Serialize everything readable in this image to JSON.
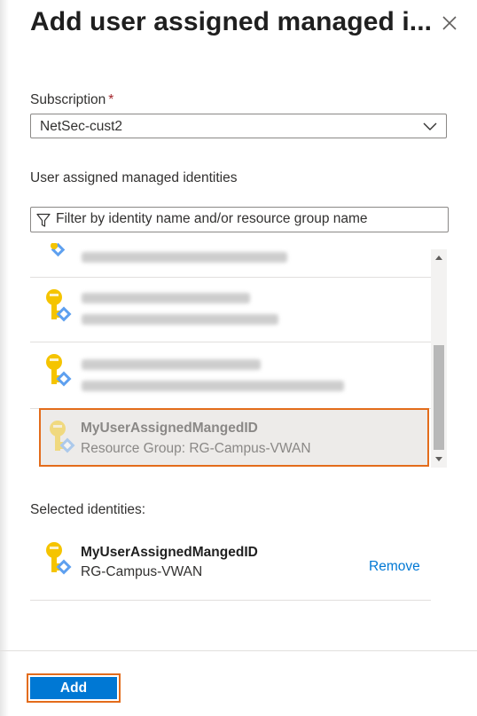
{
  "panel": {
    "title": "Add user assigned managed i...",
    "close_icon": "close-icon"
  },
  "subscription": {
    "label": "Subscription",
    "required_mark": "*",
    "value": "NetSec-cust2",
    "dropdown_icon": "chevron-down-icon"
  },
  "identities": {
    "label": "User assigned managed identities",
    "filter_placeholder": "Filter by identity name and/or resource group name",
    "filter_icon": "filter-icon",
    "list": [
      {
        "name": "",
        "resource_group": "",
        "redacted": true,
        "icon": "managed-identity-icon"
      },
      {
        "name": "",
        "resource_group": "",
        "redacted": true,
        "icon": "managed-identity-icon"
      },
      {
        "name": "",
        "resource_group": "",
        "redacted": true,
        "icon": "managed-identity-icon"
      },
      {
        "name": "MyUserAssignedMangedID",
        "resource_group": "Resource Group: RG-Campus-VWAN",
        "redacted": false,
        "selected": true,
        "icon": "managed-identity-icon"
      }
    ]
  },
  "selected": {
    "label": "Selected identities:",
    "items": [
      {
        "name": "MyUserAssignedMangedID",
        "resource_group": "RG-Campus-VWAN",
        "remove_label": "Remove",
        "icon": "managed-identity-icon"
      }
    ]
  },
  "footer": {
    "add_label": "Add"
  },
  "colors": {
    "accent": "#0078d4",
    "highlight": "#e36c1b",
    "key_yellow": "#f5c400",
    "badge_blue": "#5ea0ef"
  }
}
